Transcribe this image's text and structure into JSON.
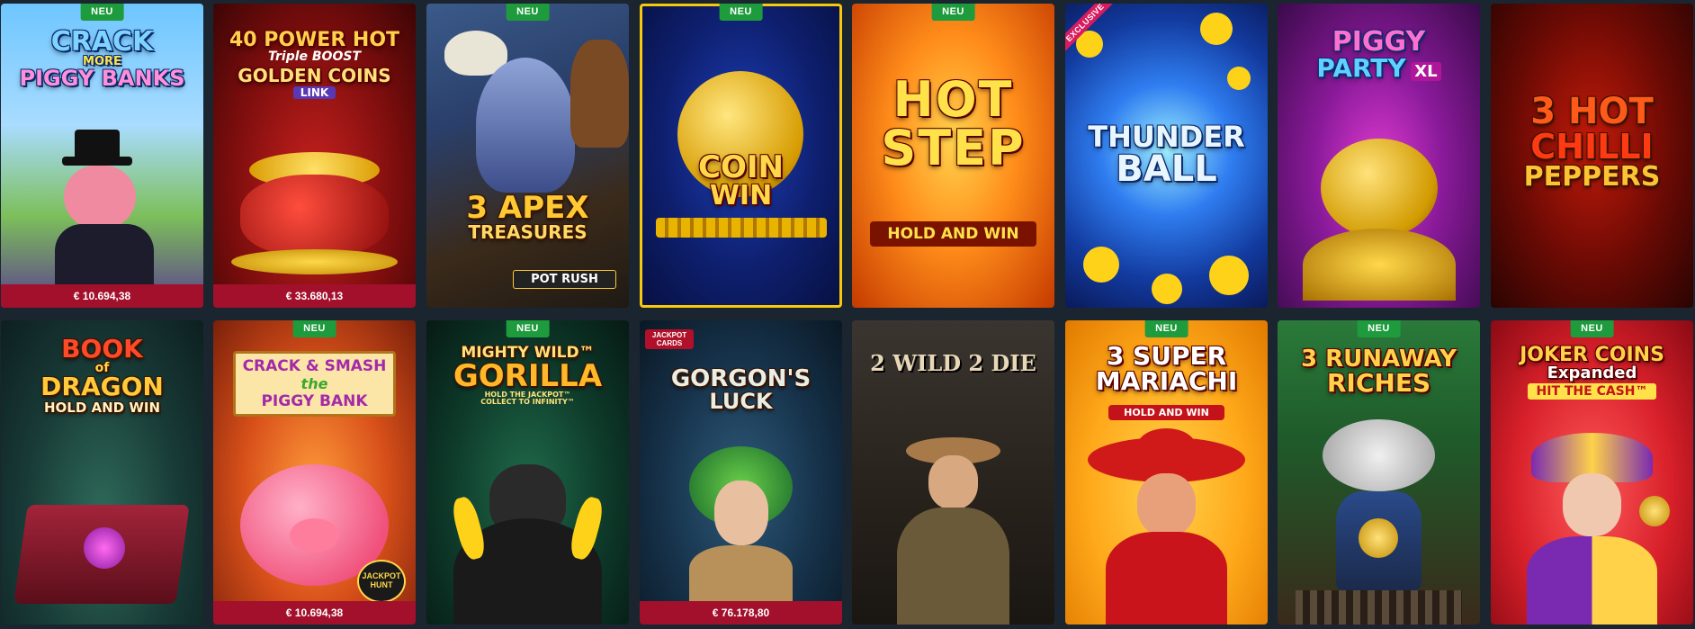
{
  "labels": {
    "new_badge": "NEU",
    "exclusive_ribbon": "EXCLUSIVE"
  },
  "games": [
    {
      "title_l1": "CRACK",
      "title_l2": "MORE",
      "title_l3": "PIGGY BANKS",
      "new": true,
      "jackpot": "€ 10.694,38"
    },
    {
      "title_l1": "40 POWER HOT",
      "title_l2": "Triple BOOST",
      "title_l3": "GOLDEN COINS",
      "title_l4": "LINK",
      "new": false,
      "jackpot": "€ 33.680,13"
    },
    {
      "title_l1": "3 APEX",
      "title_l2": "TREASURES",
      "tag": "POT RUSH",
      "new": true
    },
    {
      "title_l1": "COIN",
      "title_l2": "WIN",
      "new": true,
      "selected": true
    },
    {
      "title_l1": "HOT",
      "title_l2": "STEP",
      "title_l3": "HOLD AND WIN",
      "new": true
    },
    {
      "title_l1": "THUNDER",
      "title_l2": "BALL",
      "exclusive": true
    },
    {
      "title_l1": "PIGGY",
      "title_l2": "PARTY",
      "title_l3": "XL"
    },
    {
      "title_l1": "3 HOT",
      "title_l2": "CHILLI",
      "title_l3": "PEPPERS"
    },
    {
      "title_l1": "BOOK",
      "title_l2": "of",
      "title_l3": "DRAGON",
      "title_l4": "HOLD AND WIN"
    },
    {
      "title_l1": "CRACK & SMASH",
      "title_l2": "the",
      "title_l3": "PIGGY BANK",
      "tag": "JACKPOT HUNT",
      "new": true,
      "jackpot": "€ 10.694,38"
    },
    {
      "title_l1": "MIGHTY WILD™",
      "title_l2": "GORILLA",
      "title_l3": "HOLD THE JACKPOT™",
      "title_l4": "COLLECT TO INFINITY™",
      "new": true
    },
    {
      "title_l1": "GORGON'S",
      "title_l2": "LUCK",
      "tag": "JACKPOT CARDS",
      "jackpot": "€ 76.178,80"
    },
    {
      "title_l1": "2 WILD 2 DIE"
    },
    {
      "title_l1": "3 SUPER",
      "title_l2": "MARIACHI",
      "title_l3": "HOLD AND WIN",
      "new": true
    },
    {
      "title_l1": "3 RUNAWAY",
      "title_l2": "RICHES",
      "new": true
    },
    {
      "title_l1": "JOKER COINS",
      "title_l2": "Expanded",
      "title_l3": "HIT THE CASH™",
      "new": true
    }
  ],
  "colors": {
    "background": "#1b2530",
    "jackpot_bar": "#a3102b",
    "new_badge": "#1e9b3c",
    "selected_outline": "#f6c90e"
  }
}
